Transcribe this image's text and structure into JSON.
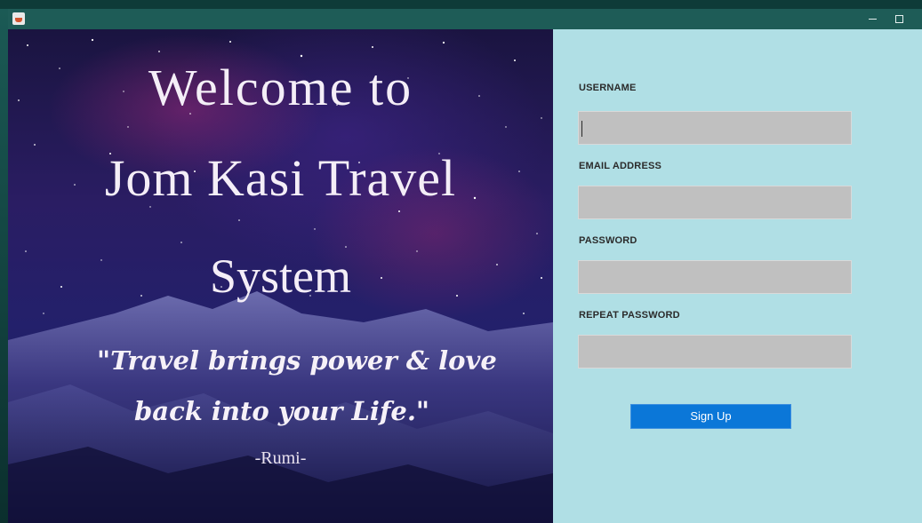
{
  "window": {
    "icon": "java-cup-icon",
    "controls": [
      "minimize-icon",
      "maximize-icon",
      "close-icon"
    ]
  },
  "hero": {
    "title_line1": "Welcome to",
    "title_line2": "Jom Kasi Travel",
    "title_line3": "System",
    "quote_line1": "\"Travel brings power & love",
    "quote_line2": "back into your Life.\"",
    "author": "-Rumi-"
  },
  "form": {
    "username_label": "USERNAME",
    "username_value": "",
    "email_label": "EMAIL ADDRESS",
    "email_value": "",
    "password_label": "PASSWORD",
    "password_value": "",
    "repeat_password_label": "REPEAT PASSWORD",
    "repeat_password_value": "",
    "signup_label": "Sign Up"
  },
  "colors": {
    "titlebar": "#1e5c57",
    "form_background": "#b0dfe5",
    "field_background": "#c0c0c0",
    "button": "#0b77d8"
  }
}
